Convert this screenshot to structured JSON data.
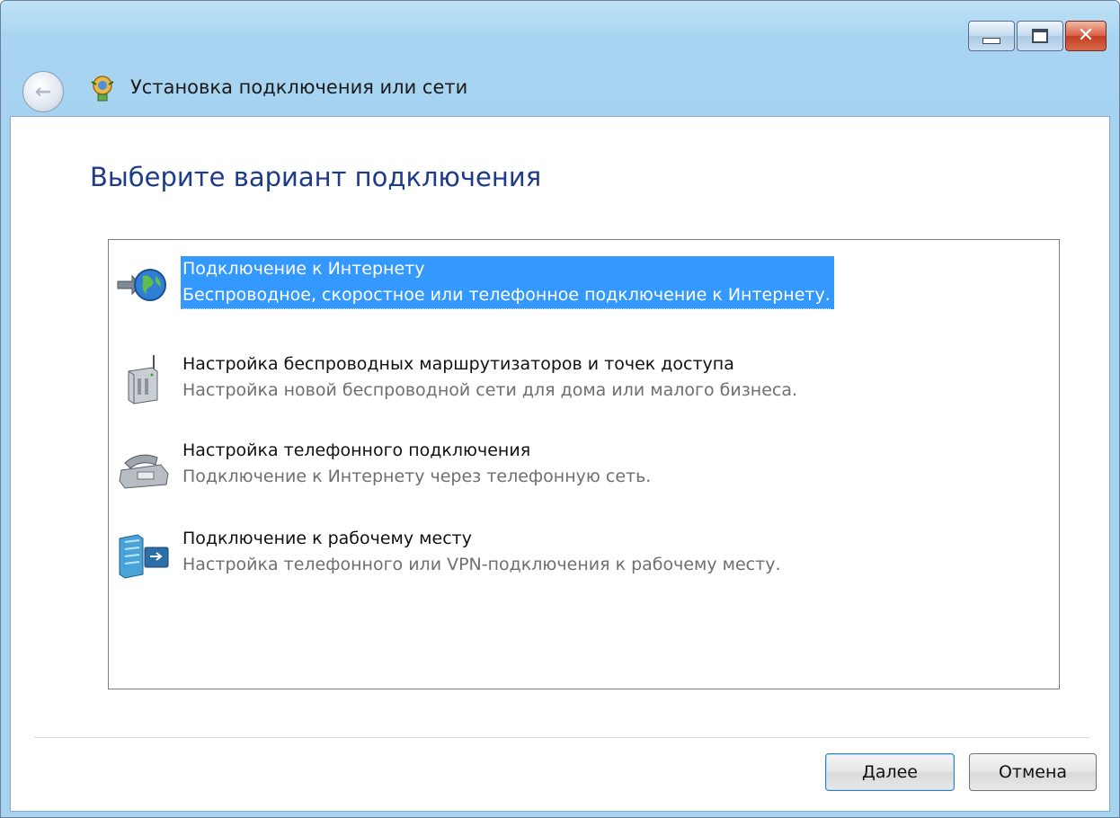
{
  "window": {
    "title": "Установка подключения или сети",
    "caption_buttons": [
      "minimize",
      "maximize",
      "close"
    ]
  },
  "heading": "Выберите вариант подключения",
  "options": [
    {
      "title": "Подключение к Интернету",
      "description": "Беспроводное, скоростное или телефонное подключение к Интернету.",
      "icon": "globe-connect-icon",
      "selected": true
    },
    {
      "title": "Настройка беспроводных маршрутизаторов и точек доступа",
      "description": "Настройка новой беспроводной сети для дома или малого бизнеса.",
      "icon": "wireless-router-icon",
      "selected": false
    },
    {
      "title": "Настройка телефонного подключения",
      "description": "Подключение к Интернету через телефонную сеть.",
      "icon": "telephone-icon",
      "selected": false
    },
    {
      "title": "Подключение к рабочему месту",
      "description": "Настройка телефонного или VPN-подключения к рабочему месту.",
      "icon": "workplace-network-icon",
      "selected": false
    }
  ],
  "buttons": {
    "next_accel": "Д",
    "next_rest": "алее",
    "cancel": "Отмена"
  },
  "colors": {
    "heading": "#1e3a8a",
    "selection": "#3399ff",
    "frame": "#a6d3f0"
  }
}
